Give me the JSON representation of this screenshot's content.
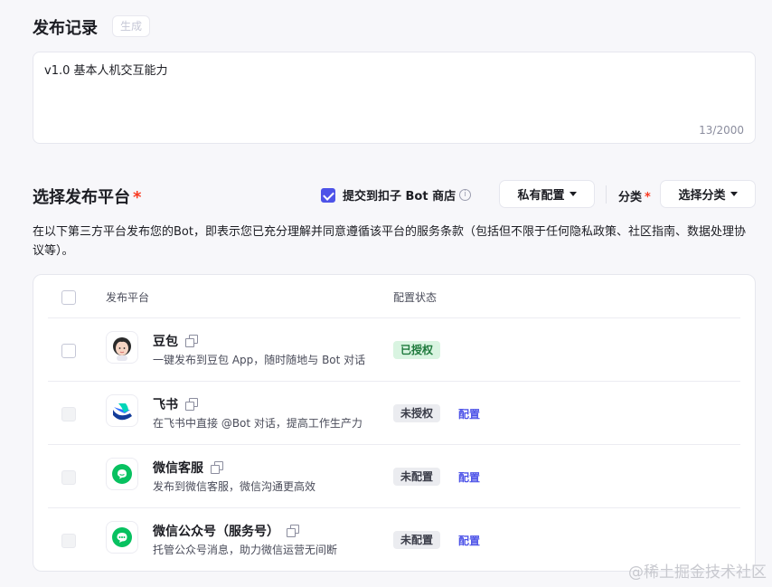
{
  "release": {
    "title": "发布记录",
    "generate_label": "生成",
    "textarea_value": "v1.0 基本人机交互能力",
    "char_count": "13/2000"
  },
  "platform": {
    "title": "选择发布平台",
    "required_mark": "*",
    "submit_label": "提交到扣子 Bot 商店",
    "submit_checked": true,
    "info_glyph": "i",
    "private_config_label": "私有配置",
    "category_label": "分类",
    "category_required": "*",
    "category_select_label": "选择分类",
    "description": "在以下第三方平台发布您的Bot，即表示您已充分理解并同意遵循该平台的服务条款（包括但不限于任何隐私政策、社区指南、数据处理协议等）。",
    "table": {
      "col_platform": "发布平台",
      "col_status": "配置状态",
      "rows": [
        {
          "name": "豆包",
          "desc": "一键发布到豆包 App，随时随地与 Bot 对话",
          "status": "已授权",
          "status_type": "ok",
          "action": "",
          "icon": "doubao-avatar-icon"
        },
        {
          "name": "飞书",
          "desc": "在飞书中直接 @Bot 对话，提高工作生产力",
          "status": "未授权",
          "status_type": "no",
          "action": "配置",
          "icon": "feishu-icon"
        },
        {
          "name": "微信客服",
          "desc": "发布到微信客服，微信沟通更高效",
          "status": "未配置",
          "status_type": "no",
          "action": "配置",
          "icon": "wechat-service-icon"
        },
        {
          "name": "微信公众号（服务号）",
          "desc": "托管公众号消息，助力微信运营无间断",
          "status": "未配置",
          "status_type": "no",
          "action": "配置",
          "icon": "wechat-official-icon"
        }
      ]
    }
  },
  "watermark": "@稀土掘金技术社区",
  "colors": {
    "accent": "#4d53e8",
    "required": "#f93920",
    "success_bg": "#d9f4e1",
    "wechat_green": "#07c160"
  }
}
